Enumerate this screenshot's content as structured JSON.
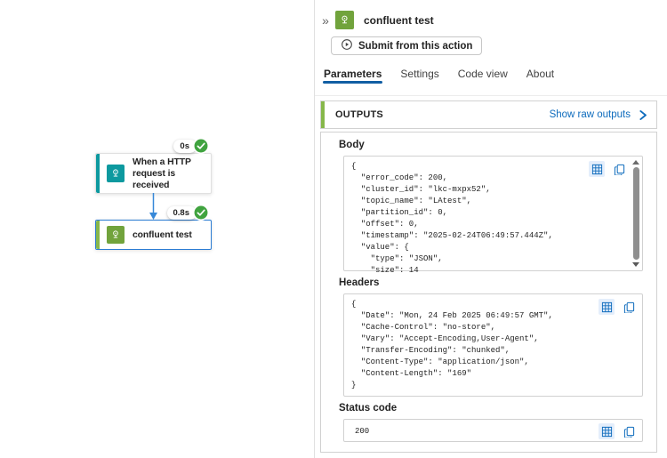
{
  "colors": {
    "connector_green": "#71a33c",
    "accent_green": "#86b74a",
    "trigger_teal": "#0d999f",
    "link_blue": "#0f6cbd",
    "tab_underline_blue": "#115ea3",
    "success_green": "#40a33f",
    "selection_blue": "#2b7cd3",
    "arrow_blue": "#3788d8"
  },
  "icons": {
    "collapse_glyph": "»",
    "collapse": "double-chevron-right",
    "connector": "kafka-connector",
    "submit": "resubmit-play-circle",
    "success": "check-circle",
    "table_view": "table-grid",
    "copy": "copy-pages",
    "show_raw_chevron": "chevron-right",
    "scroll_up": "triangle-up",
    "scroll_down": "triangle-down"
  },
  "canvas": {
    "trigger_node": {
      "label": "When a HTTP request is received",
      "duration": "0s",
      "status": "succeeded"
    },
    "action_node": {
      "label": "confluent test",
      "duration": "0.8s",
      "status": "succeeded",
      "selected": true
    }
  },
  "panel": {
    "title": "confluent test",
    "submit_button_label": "Submit from this action",
    "tabs": [
      "Parameters",
      "Settings",
      "Code view",
      "About"
    ],
    "active_tab": "Parameters",
    "outputs": {
      "section_title": "OUTPUTS",
      "show_raw_link": "Show raw outputs",
      "fields": {
        "body": {
          "label": "Body",
          "code": "{\n  \"error_code\": 200,\n  \"cluster_id\": \"lkc-mxpx52\",\n  \"topic_name\": \"LAtest\",\n  \"partition_id\": 0,\n  \"offset\": 0,\n  \"timestamp\": \"2025-02-24T06:49:57.444Z\",\n  \"value\": {\n    \"type\": \"JSON\",\n    \"size\": 14"
        },
        "headers": {
          "label": "Headers",
          "code": "{\n  \"Date\": \"Mon, 24 Feb 2025 06:49:57 GMT\",\n  \"Cache-Control\": \"no-store\",\n  \"Vary\": \"Accept-Encoding,User-Agent\",\n  \"Transfer-Encoding\": \"chunked\",\n  \"Content-Type\": \"application/json\",\n  \"Content-Length\": \"169\"\n}"
        },
        "status": {
          "label": "Status code",
          "value": "200"
        }
      }
    }
  }
}
